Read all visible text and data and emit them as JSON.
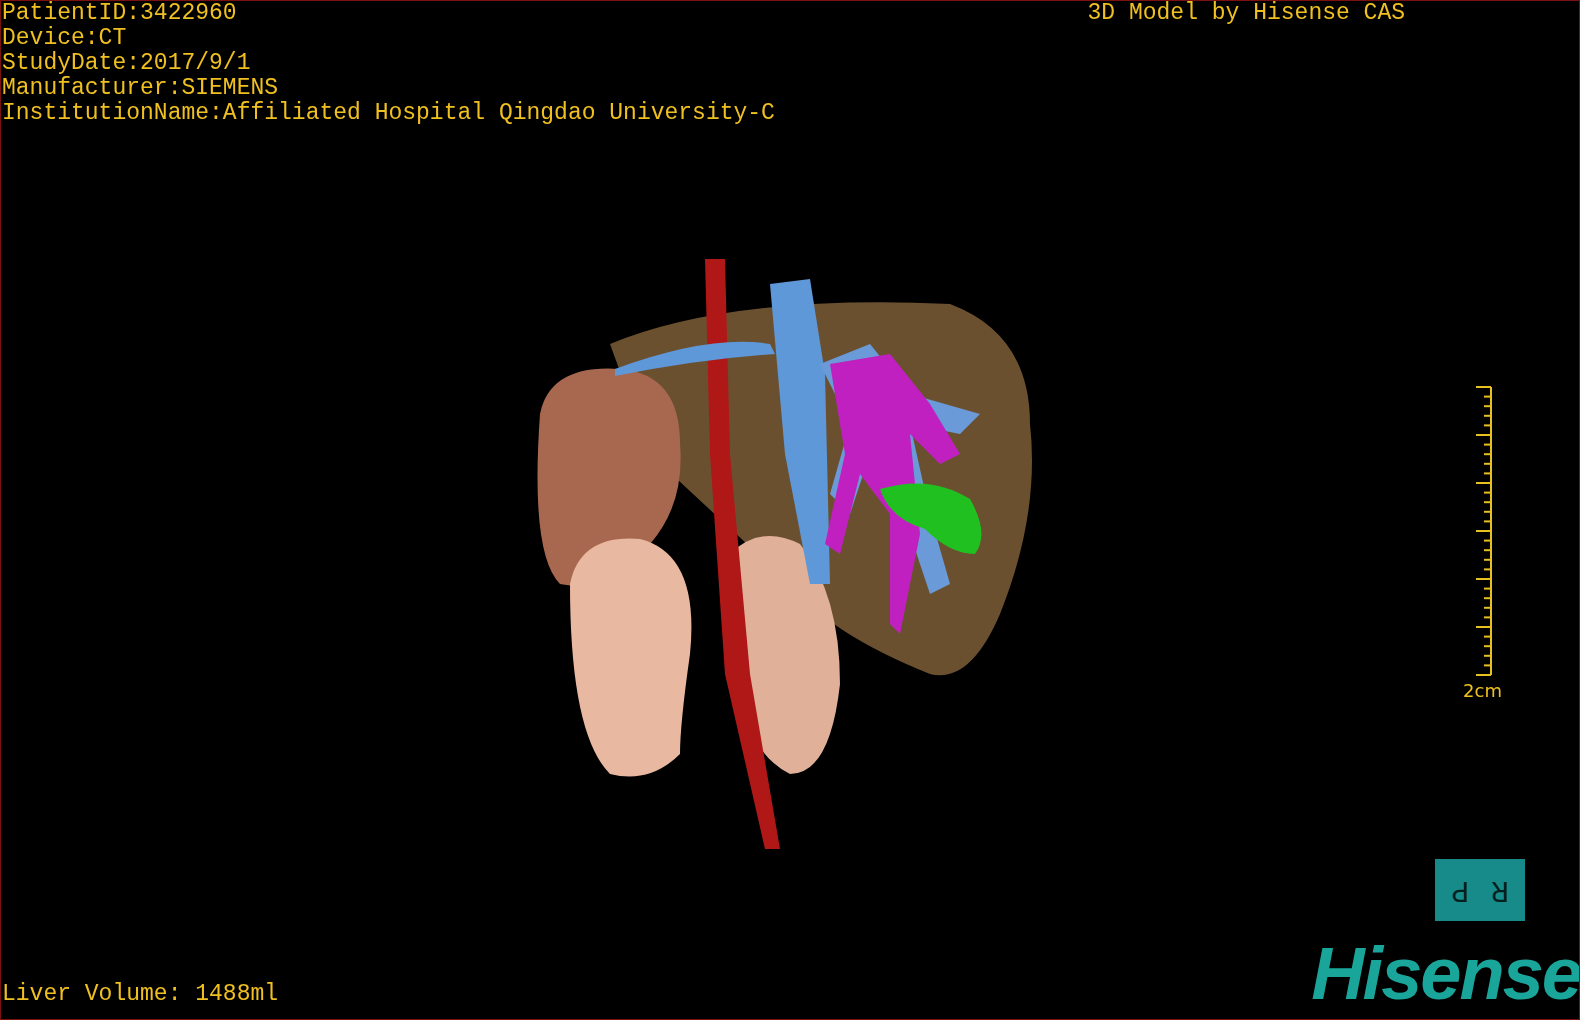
{
  "info_lines": [
    "PatientID:3422960",
    "Device:CT",
    "StudyDate:2017/9/1",
    "Manufacturer:SIEMENS",
    "InstitutionName:Affiliated Hospital Qingdao University-C"
  ],
  "title": "3D Model by Hisense CAS",
  "scale_bar": {
    "label": "2cm"
  },
  "orientation_marker": {
    "labels": [
      "P",
      "R"
    ]
  },
  "liver_volume": "Liver Volume: 1488ml",
  "logo": "Hisense"
}
